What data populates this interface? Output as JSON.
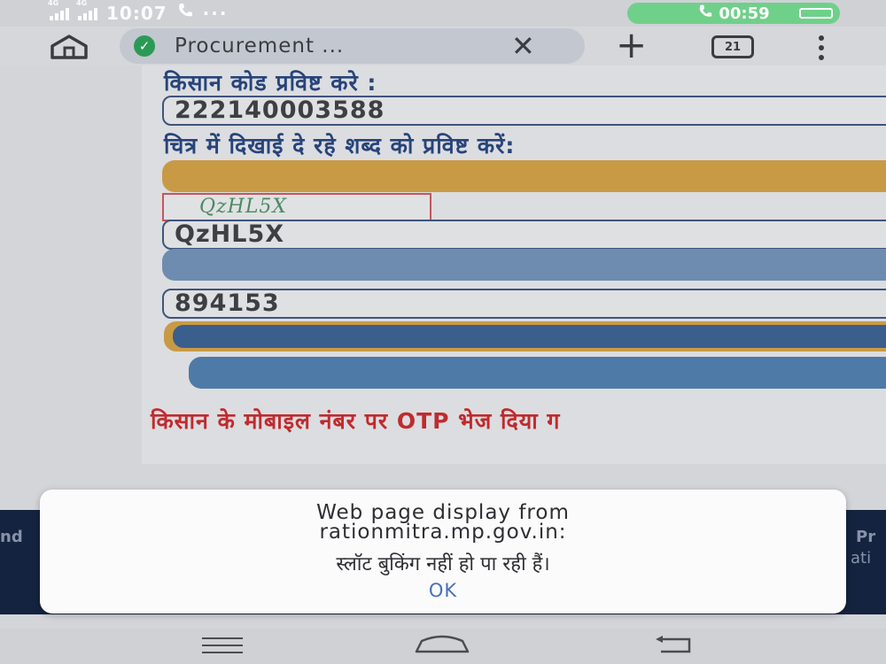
{
  "status_bar": {
    "net1": "4G",
    "net2": "4G",
    "time": "10:07",
    "more": "···",
    "call_timer": "00:59"
  },
  "browser": {
    "tab_title": "Procurement ...",
    "tab_count": "21"
  },
  "form": {
    "kisan_code_label": "किसान कोड प्रविष्ट करे :",
    "kisan_code_value": "222140003588",
    "captcha_label": "चित्र में दिखाई दे रहे शब्द को प्रविष्ट करें:",
    "captcha_image_text": "QzHL5X",
    "captcha_value": "QzHL5X",
    "otp_value": "894153",
    "otp_sent_message": "किसान के मोबाइल नंबर पर OTP भेज दिया ग"
  },
  "background_edges": {
    "left": "nd",
    "right_top": "Pr",
    "right_bottom": "ati"
  },
  "dialog": {
    "title_line1": "Web page display from",
    "title_line2": "rationmitra.mp.gov.in:",
    "message": "स्लॉट बुकिंग नहीं हो पा रही हैं।",
    "ok_label": "OK"
  },
  "colors": {
    "accent_blue": "#27447a",
    "error_red": "#bf2b2e",
    "call_green": "#6fd08a",
    "dialog_link": "#4a6fbf"
  }
}
